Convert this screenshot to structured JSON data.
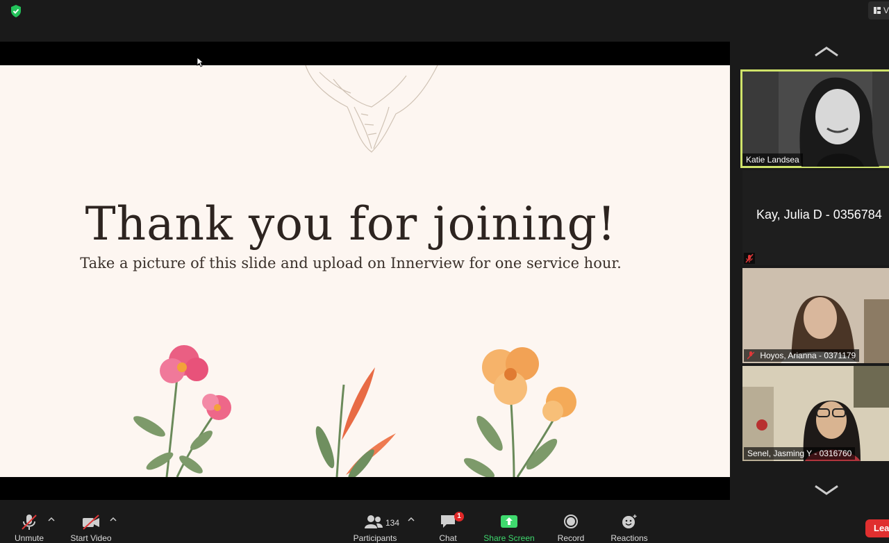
{
  "topbar": {
    "view_label": "V"
  },
  "slide": {
    "title": "Thank you for joining!",
    "subtitle": "Take a picture of this slide and upload on Innerview for one service hour."
  },
  "participants": [
    {
      "name": "Katie Landsea",
      "active": true
    },
    {
      "name": "Kay, Julia D - 0356784",
      "video": false,
      "muted": true
    },
    {
      "name": "Hoyos, Arianna - 0371179",
      "muted": true
    },
    {
      "name": "Senel, Jasming Y - 0316760",
      "muted": false
    }
  ],
  "toolbar": {
    "unmute": "Unmute",
    "start_video": "Start Video",
    "participants": "Participants",
    "participants_count": "134",
    "chat": "Chat",
    "chat_badge": "1",
    "share_screen": "Share Screen",
    "record": "Record",
    "reactions": "Reactions",
    "leave": "Lea"
  },
  "colors": {
    "accent_green": "#3fd96e",
    "active_speaker": "#cfe36a",
    "leave_red": "#e02f2f",
    "slide_bg": "#fdf6f1"
  }
}
